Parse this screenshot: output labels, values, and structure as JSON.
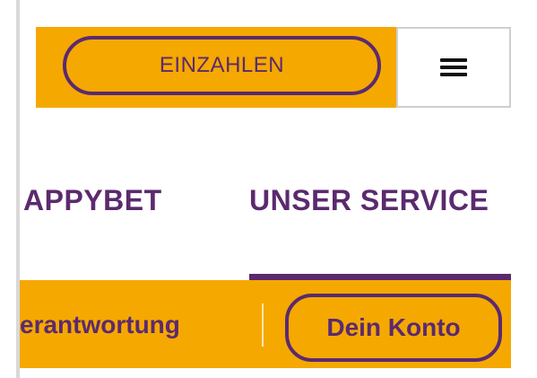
{
  "header": {
    "deposit_label": "EINZAHLEN",
    "menu_icon": "hamburger-icon"
  },
  "nav": {
    "items": [
      {
        "label": "APPYBET"
      },
      {
        "label": "UNSER SERVICE",
        "active": true
      }
    ]
  },
  "subnav": {
    "items": [
      {
        "label": "erantwortung"
      },
      {
        "label": "Dein Konto"
      }
    ]
  },
  "colors": {
    "accent": "#f5a800",
    "brand": "#5b2a6e",
    "text": "#5b2a6e"
  }
}
